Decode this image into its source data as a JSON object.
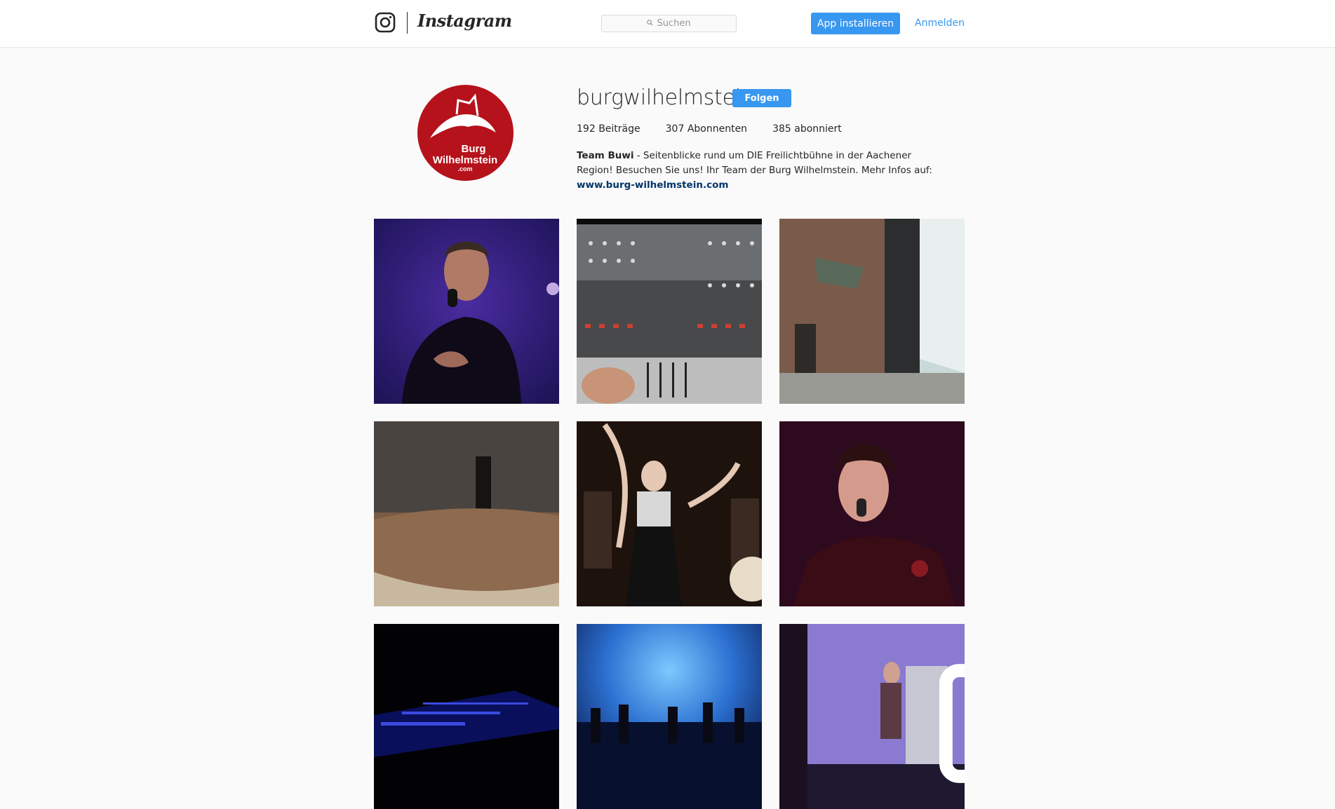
{
  "nav": {
    "logo_icon": "instagram-glyph-icon",
    "wordmark": "Instagram",
    "search_placeholder": "Suchen",
    "install_button": "App installieren",
    "login_link": "Anmelden"
  },
  "profile": {
    "avatar_text": [
      "Burg",
      "Wilhelmstein",
      ".com"
    ],
    "username": "burgwilhelmstein",
    "follow_button": "Folgen",
    "stats": [
      {
        "count": "192",
        "label": "Beiträge"
      },
      {
        "count": "307",
        "label": "Abonnenten"
      },
      {
        "count": "385",
        "label": "abonniert"
      }
    ],
    "bio_name": "Team Buwi",
    "bio_text": " - Seitenblicke rund um DIE Freilichtbühne in der Aachener Region! Besuchen Sie uns! Ihr Team der Burg Wilhelmstein. Mehr Infos auf: ",
    "bio_link": "www.burg-wilhelmstein.com"
  },
  "posts": [
    {
      "subject": "singer with microphone on purple stage"
    },
    {
      "subject": "mixing console with hand on faders"
    },
    {
      "subject": "castle wall and stage tent"
    },
    {
      "subject": "stone wall with autumn leaves"
    },
    {
      "subject": "singer with raised arms and band"
    },
    {
      "subject": "female singer with microphone"
    },
    {
      "subject": "dark stage with blue lights"
    },
    {
      "subject": "band on blue lit stage"
    },
    {
      "subject": "guitarist with speakers, video post",
      "video_icon": "video-camera-icon"
    }
  ],
  "colors": {
    "accent": "#3897f0",
    "link": "#003569",
    "avatar_red": "#b5121b"
  }
}
